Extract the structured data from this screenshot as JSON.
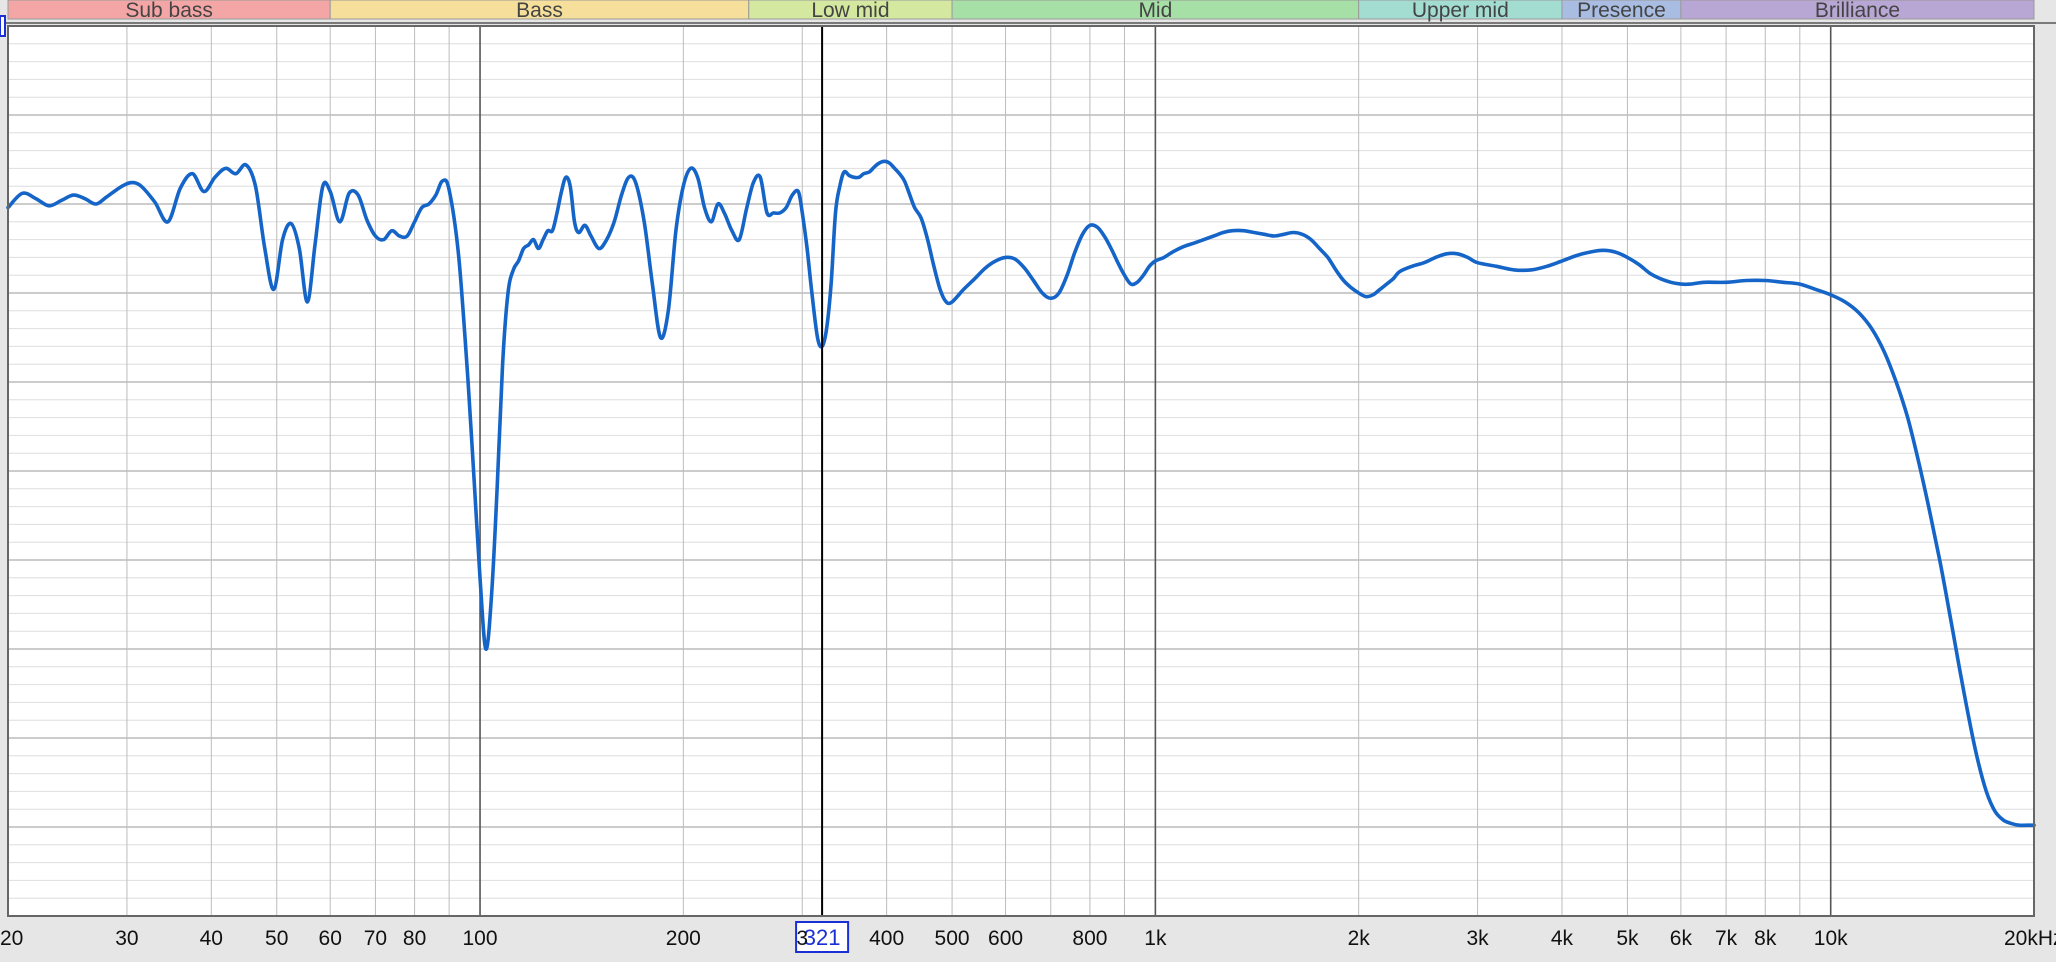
{
  "chart_data": {
    "type": "line",
    "title": "",
    "xlabel": "",
    "ylabel": "",
    "x_scale": "log",
    "xlim": [
      20,
      20000
    ],
    "ylim": [
      -40,
      10
    ],
    "grid": true,
    "colors": {
      "curve": "#1565c8",
      "background": "#ffffff",
      "grid_minor": "#dedede",
      "grid_major": "#bcbcbc",
      "cursor": "#000000",
      "cursor_label": "#1a2fd4"
    },
    "bands": [
      {
        "name": "Sub bass",
        "from": 20,
        "to": 60,
        "color": "#f4a6a6"
      },
      {
        "name": "Bass",
        "from": 60,
        "to": 250,
        "color": "#f5df9b"
      },
      {
        "name": "Low mid",
        "from": 250,
        "to": 500,
        "color": "#d4e8a0"
      },
      {
        "name": "Mid",
        "from": 500,
        "to": 2000,
        "color": "#a6e0a6"
      },
      {
        "name": "Upper mid",
        "from": 2000,
        "to": 4000,
        "color": "#a3dcd1"
      },
      {
        "name": "Presence",
        "from": 4000,
        "to": 6000,
        "color": "#a9bde3"
      },
      {
        "name": "Brilliance",
        "from": 6000,
        "to": 20000,
        "color": "#b8a7d4"
      }
    ],
    "x_ticks": [
      {
        "value": 20,
        "label": "20"
      },
      {
        "value": 30,
        "label": "30"
      },
      {
        "value": 40,
        "label": "40"
      },
      {
        "value": 50,
        "label": "50"
      },
      {
        "value": 60,
        "label": "60"
      },
      {
        "value": 70,
        "label": "70"
      },
      {
        "value": 80,
        "label": "80"
      },
      {
        "value": 100,
        "label": "100"
      },
      {
        "value": 200,
        "label": "200"
      },
      {
        "value": 300,
        "label": "3"
      },
      {
        "value": 400,
        "label": "400"
      },
      {
        "value": 500,
        "label": "500"
      },
      {
        "value": 600,
        "label": "600"
      },
      {
        "value": 800,
        "label": "800"
      },
      {
        "value": 1000,
        "label": "1k"
      },
      {
        "value": 2000,
        "label": "2k"
      },
      {
        "value": 3000,
        "label": "3k"
      },
      {
        "value": 4000,
        "label": "4k"
      },
      {
        "value": 5000,
        "label": "5k"
      },
      {
        "value": 6000,
        "label": "6k"
      },
      {
        "value": 7000,
        "label": "7k"
      },
      {
        "value": 8000,
        "label": "8k"
      },
      {
        "value": 10000,
        "label": "10k"
      },
      {
        "value": 20000,
        "label": "20kHz"
      }
    ],
    "cursor": {
      "x": 321,
      "label": "321"
    },
    "series": [
      {
        "x": [
          20,
          21,
          22,
          23,
          24,
          25,
          26,
          27,
          28,
          29.5,
          30.5,
          31.5,
          33,
          34.5,
          36,
          37.5,
          39,
          40.5,
          42,
          43.5,
          45,
          46.5,
          48,
          49.5,
          51,
          52.5,
          54,
          55.5,
          57,
          58.5,
          60,
          62,
          64,
          66,
          68,
          70,
          72,
          74,
          76,
          78,
          80,
          82,
          84,
          86,
          88,
          90,
          93,
          96,
          98,
          100,
          102,
          104,
          106,
          108,
          110,
          112,
          114,
          116,
          118,
          120,
          122,
          124,
          126,
          128,
          130,
          132,
          134,
          136,
          138,
          140,
          143,
          146,
          150,
          154,
          158,
          162,
          166,
          170,
          175,
          180,
          185,
          190,
          195,
          200,
          205,
          210,
          215,
          220,
          225,
          230,
          236,
          242,
          248,
          254,
          260,
          266,
          272,
          278,
          284,
          290,
          296,
          300,
          305,
          310,
          316,
          321,
          326,
          331,
          336,
          341,
          346,
          352,
          358,
          364,
          370,
          377,
          384,
          390,
          397,
          404,
          411,
          418,
          425,
          432,
          440,
          450,
          460,
          470,
          480,
          490,
          500,
          520,
          540,
          560,
          580,
          600,
          620,
          640,
          660,
          680,
          700,
          720,
          740,
          760,
          780,
          800,
          820,
          840,
          860,
          880,
          900,
          920,
          940,
          960,
          980,
          1000,
          1030,
          1060,
          1100,
          1140,
          1180,
          1220,
          1260,
          1300,
          1350,
          1400,
          1450,
          1500,
          1550,
          1600,
          1650,
          1700,
          1750,
          1800,
          1850,
          1900,
          1950,
          2000,
          2050,
          2100,
          2150,
          2200,
          2250,
          2300,
          2400,
          2500,
          2600,
          2700,
          2800,
          2900,
          3000,
          3200,
          3400,
          3600,
          3800,
          4000,
          4200,
          4400,
          4600,
          4800,
          5000,
          5200,
          5400,
          5600,
          5800,
          6000,
          6200,
          6500,
          7000,
          7500,
          8000,
          8500,
          9000,
          9500,
          10000,
          10500,
          11000,
          11500,
          12000,
          12500,
          13000,
          13500,
          14000,
          14500,
          15000,
          15500,
          16000,
          16500,
          17000,
          17500,
          18000,
          18500,
          19000,
          19500,
          20000
        ],
        "y": [
          -0.2,
          0.6,
          0.3,
          -0.1,
          0.2,
          0.5,
          0.3,
          0.0,
          0.4,
          1.0,
          1.2,
          1.0,
          0.1,
          -1.0,
          0.9,
          1.7,
          0.7,
          1.5,
          2.0,
          1.7,
          2.2,
          1.0,
          -2.5,
          -4.8,
          -2.0,
          -1.1,
          -2.5,
          -5.5,
          -2.2,
          1.0,
          0.7,
          -1.0,
          0.6,
          0.5,
          -0.9,
          -1.8,
          -2.0,
          -1.5,
          -1.8,
          -1.8,
          -1.0,
          -0.2,
          0.0,
          0.5,
          1.3,
          0.8,
          -3.0,
          -10.0,
          -15.5,
          -21.0,
          -25.0,
          -22.0,
          -16.0,
          -9.0,
          -5.0,
          -3.7,
          -3.2,
          -2.5,
          -2.3,
          -2.0,
          -2.5,
          -2.0,
          -1.5,
          -1.5,
          -0.5,
          0.7,
          1.5,
          1.0,
          -1.0,
          -1.6,
          -1.2,
          -1.8,
          -2.5,
          -2.0,
          -1.0,
          0.5,
          1.5,
          1.2,
          -1.0,
          -4.5,
          -7.5,
          -6.0,
          -1.5,
          1.0,
          2.0,
          1.5,
          -0.2,
          -1.0,
          0.0,
          -0.5,
          -1.5,
          -2.0,
          -0.3,
          1.2,
          1.5,
          -0.5,
          -0.5,
          -0.5,
          -0.2,
          0.5,
          0.7,
          -0.5,
          -2.5,
          -5.0,
          -7.5,
          -8.0,
          -7.0,
          -4.5,
          -0.5,
          1.0,
          1.8,
          1.6,
          1.5,
          1.5,
          1.7,
          1.8,
          2.1,
          2.3,
          2.4,
          2.3,
          2.0,
          1.7,
          1.3,
          0.6,
          -0.2,
          -0.8,
          -2.0,
          -3.5,
          -4.8,
          -5.5,
          -5.5,
          -4.8,
          -4.2,
          -3.6,
          -3.2,
          -3.0,
          -3.1,
          -3.6,
          -4.3,
          -5.0,
          -5.3,
          -5.0,
          -4.0,
          -2.7,
          -1.7,
          -1.2,
          -1.3,
          -1.8,
          -2.5,
          -3.3,
          -4.0,
          -4.5,
          -4.4,
          -4.0,
          -3.5,
          -3.2,
          -3.0,
          -2.7,
          -2.4,
          -2.2,
          -2.0,
          -1.8,
          -1.6,
          -1.5,
          -1.5,
          -1.6,
          -1.7,
          -1.8,
          -1.7,
          -1.6,
          -1.7,
          -2.0,
          -2.5,
          -3.0,
          -3.7,
          -4.3,
          -4.7,
          -5.0,
          -5.2,
          -5.1,
          -4.8,
          -4.5,
          -4.2,
          -3.8,
          -3.5,
          -3.3,
          -3.0,
          -2.8,
          -2.8,
          -3.0,
          -3.3,
          -3.5,
          -3.7,
          -3.7,
          -3.5,
          -3.2,
          -2.9,
          -2.7,
          -2.6,
          -2.7,
          -3.0,
          -3.4,
          -3.9,
          -4.2,
          -4.4,
          -4.5,
          -4.5,
          -4.4,
          -4.4,
          -4.3,
          -4.3,
          -4.4,
          -4.5,
          -4.8,
          -5.1,
          -5.5,
          -6.1,
          -7.0,
          -8.3,
          -10.0,
          -12.0,
          -14.5,
          -17.2,
          -20.0,
          -23.0,
          -26.0,
          -28.8,
          -31.2,
          -33.0,
          -34.1,
          -34.6,
          -34.8,
          -34.9,
          -34.9,
          -34.9
        ]
      }
    ]
  }
}
